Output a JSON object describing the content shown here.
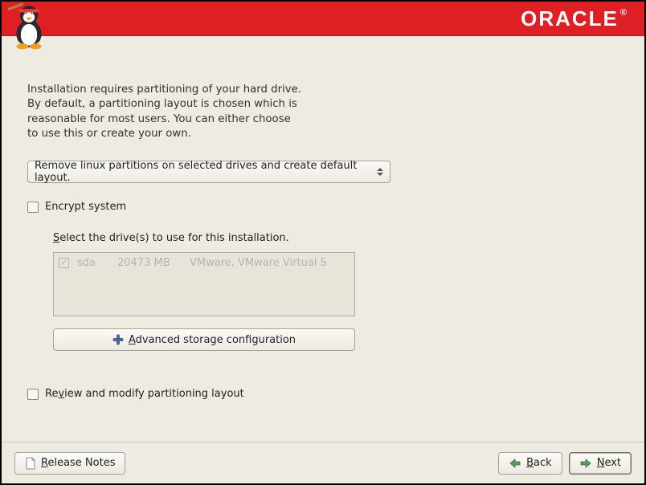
{
  "brand": "ORACLE",
  "intro_line1": "Installation requires partitioning of your hard drive.",
  "intro_line2": "By default, a partitioning layout is chosen which is",
  "intro_line3": "reasonable for most users.  You can either choose",
  "intro_line4": "to use this or create your own.",
  "dropdown": {
    "selected": "Remove linux partitions on selected drives and create default layout."
  },
  "encrypt_label": "Encrypt system",
  "drive_section": {
    "label_prefix": "S",
    "label_rest": "elect the drive(s) to use for this installation.",
    "items": [
      {
        "name": "sda",
        "size": "20473 MB",
        "desc": "VMware, VMware Virtual S"
      }
    ]
  },
  "advanced_btn": {
    "label_u": "A",
    "label_rest": "dvanced storage configuration"
  },
  "review_label_pre": "Re",
  "review_label_u": "v",
  "review_label_post": "iew and modify partitioning layout",
  "footer": {
    "release_u": "R",
    "release_rest": "elease Notes",
    "back_u": "B",
    "back_rest": "ack",
    "next_u": "N",
    "next_rest": "ext"
  }
}
